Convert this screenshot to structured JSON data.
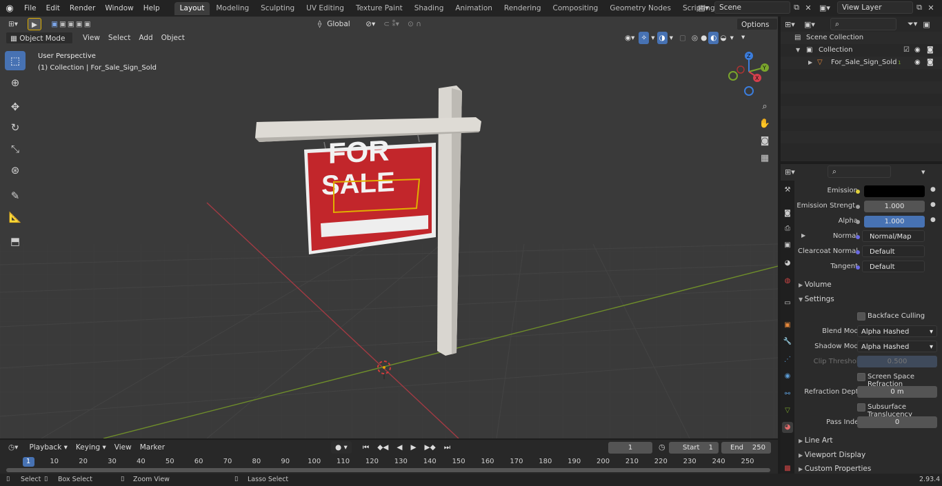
{
  "menu": [
    "File",
    "Edit",
    "Render",
    "Window",
    "Help"
  ],
  "workspaces": [
    {
      "label": "Layout",
      "active": true
    },
    {
      "label": "Modeling"
    },
    {
      "label": "Sculpting"
    },
    {
      "label": "UV Editing"
    },
    {
      "label": "Texture Paint"
    },
    {
      "label": "Shading"
    },
    {
      "label": "Animation"
    },
    {
      "label": "Rendering"
    },
    {
      "label": "Compositing"
    },
    {
      "label": "Geometry Nodes"
    },
    {
      "label": "Scripting"
    }
  ],
  "add_workspace": "+",
  "scene": "Scene",
  "view_layer": "View Layer",
  "viewport": {
    "mode": "Object Mode",
    "menus": [
      "View",
      "Select",
      "Add",
      "Object"
    ],
    "orientation": "Global",
    "options": "Options",
    "perspective": "User Perspective",
    "collection_info": "(1) Collection | For_Sale_Sign_Sold",
    "sign_text_top": "FOR",
    "sign_text_bottom": "SALE",
    "gizmo": {
      "x": "X",
      "y": "Y",
      "z": "Z"
    }
  },
  "outliner": {
    "scene_collection": "Scene Collection",
    "collection": "Collection",
    "object": "For_Sale_Sign_Sold",
    "object_badge": "1"
  },
  "properties": {
    "emission_label": "Emission",
    "emission_color": "#000000",
    "emission_strength_label": "Emission Strengt",
    "emission_strength": "1.000",
    "alpha_label": "Alpha",
    "alpha": "1.000",
    "normal_label": "Normal",
    "normal": "Normal/Map",
    "clearcoat_normal_label": "Clearcoat Normal",
    "clearcoat_normal": "Default",
    "tangent_label": "Tangent",
    "tangent": "Default",
    "volume": "Volume",
    "settings": "Settings",
    "backface_culling": "Backface Culling",
    "blend_mode_label": "Blend Mode",
    "blend_mode": "Alpha Hashed",
    "shadow_mode_label": "Shadow Mode",
    "shadow_mode": "Alpha Hashed",
    "clip_threshold_label": "Clip Threshold",
    "clip_threshold": "0.500",
    "ssr": "Screen Space Refraction",
    "refraction_depth_label": "Refraction Depth",
    "refraction_depth": "0 m",
    "subsurface": "Subsurface Translucency",
    "pass_index_label": "Pass Index",
    "pass_index": "0",
    "line_art": "Line Art",
    "viewport_display": "Viewport Display",
    "custom_properties": "Custom Properties"
  },
  "timeline": {
    "menus": [
      "Playback",
      "Keying",
      "View",
      "Marker"
    ],
    "current_frame": "1",
    "start_label": "Start",
    "start": "1",
    "end_label": "End",
    "end": "250",
    "ticks": [
      "1",
      "10",
      "20",
      "30",
      "40",
      "50",
      "60",
      "70",
      "80",
      "90",
      "100",
      "110",
      "120",
      "130",
      "140",
      "150",
      "160",
      "170",
      "180",
      "190",
      "200",
      "210",
      "220",
      "230",
      "240",
      "250"
    ]
  },
  "status": {
    "select": "Select",
    "box_select": "Box Select",
    "zoom_view": "Zoom View",
    "lasso_select": "Lasso Select",
    "version": "2.93.4"
  },
  "colors": {
    "accent": "#4772b3",
    "active_tab": "#3d3d3d",
    "x_axis": "#c23b48",
    "y_axis": "#7ea02f",
    "sign_red": "#c2262b"
  }
}
